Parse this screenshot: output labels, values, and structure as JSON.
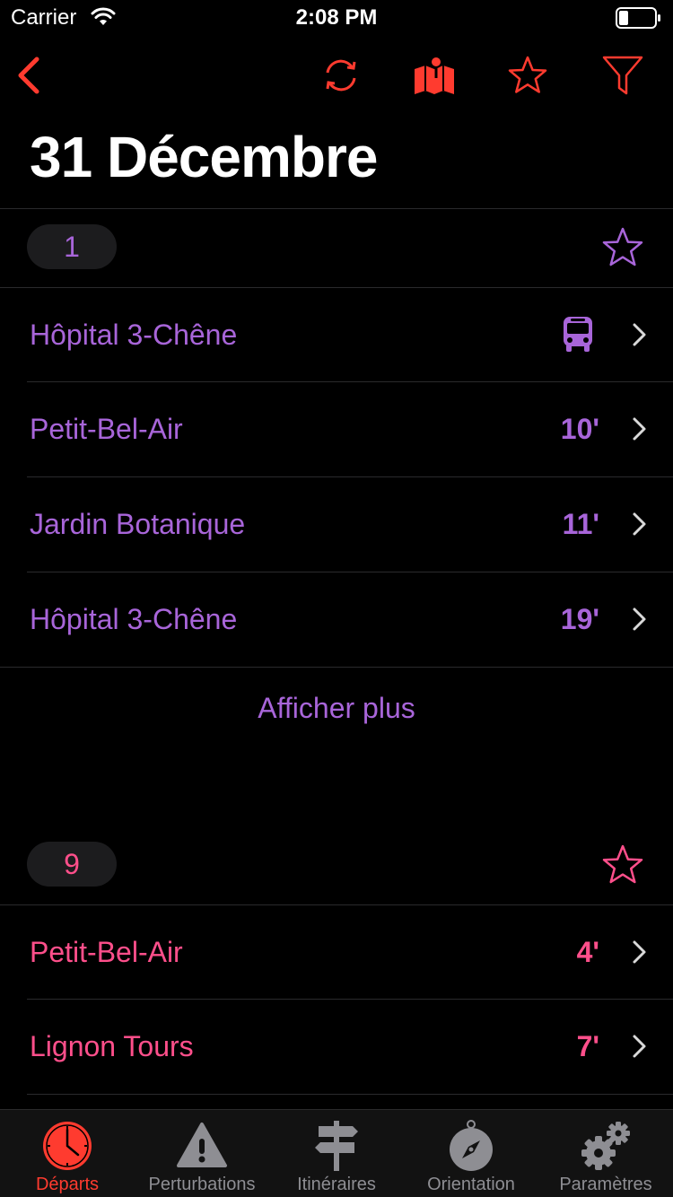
{
  "status": {
    "carrier": "Carrier",
    "time": "2:08 PM"
  },
  "colors": {
    "accent": "#ff3b2f",
    "line1": "#a865d9",
    "line9": "#ff4f8b",
    "inactive": "#8e8e93"
  },
  "nav": {
    "icons": [
      "back-chevron-icon",
      "refresh-icon",
      "map-icon",
      "star-icon",
      "filter-icon"
    ]
  },
  "title": "31 Décembre",
  "lines": [
    {
      "number": "1",
      "rows": [
        {
          "destination": "Hôpital 3-Chêne",
          "time": "",
          "icon": "bus-icon"
        },
        {
          "destination": "Petit-Bel-Air",
          "time": "10'"
        },
        {
          "destination": "Jardin Botanique",
          "time": "11'"
        },
        {
          "destination": "Hôpital 3-Chêne",
          "time": "19'"
        }
      ],
      "show_more": "Afficher plus"
    },
    {
      "number": "9",
      "rows": [
        {
          "destination": "Petit-Bel-Air",
          "time": "4'"
        },
        {
          "destination": "Lignon Tours",
          "time": "7'"
        }
      ]
    }
  ],
  "tabs": [
    {
      "label": "Départs",
      "icon": "clock-icon",
      "active": true
    },
    {
      "label": "Perturbations",
      "icon": "warning-icon",
      "active": false
    },
    {
      "label": "Itinéraires",
      "icon": "signpost-icon",
      "active": false
    },
    {
      "label": "Orientation",
      "icon": "compass-icon",
      "active": false
    },
    {
      "label": "Paramètres",
      "icon": "gears-icon",
      "active": false
    }
  ]
}
